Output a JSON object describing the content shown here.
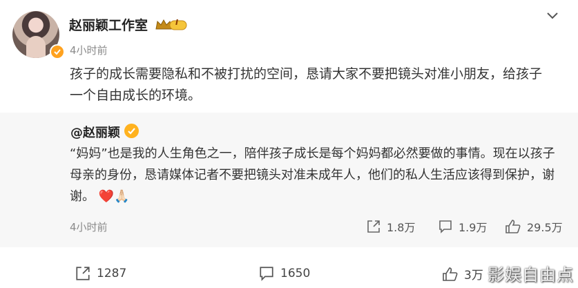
{
  "post": {
    "author": "赵丽颖工作室",
    "level_badge": "I",
    "time": "4小时前",
    "text": "孩子的成长需要隐私和不被打扰的空间，恳请大家不要把镜头对准小朋友，给孩子一个自由成长的环境。",
    "icons": {
      "avatar": "avatar-image",
      "verified": "verified-badge-icon",
      "crown": "crown-icon",
      "more": "chevron-down-icon"
    }
  },
  "repost": {
    "author": "@赵丽颖",
    "text": "“妈妈”也是我的人生角色之一，陪伴孩子成长是每个妈妈都必然要做的事情。现在以孩子母亲的身份，恳请媒体记者不要把镜头对准未成年人，他们的私人生活应该得到保护，谢谢。",
    "emoji": "❤️🙏🏻",
    "time": "4小时前",
    "stats": {
      "shares": "1.8万",
      "comments": "1.9万",
      "likes": "29.5万"
    }
  },
  "footer": {
    "shares": "1287",
    "comments": "1650",
    "likes": "3万"
  },
  "watermark": "影娱自由点",
  "colors": {
    "accent": "#ffa21f",
    "repost_bg": "#f7f7f7",
    "heart": "#e8342c"
  }
}
